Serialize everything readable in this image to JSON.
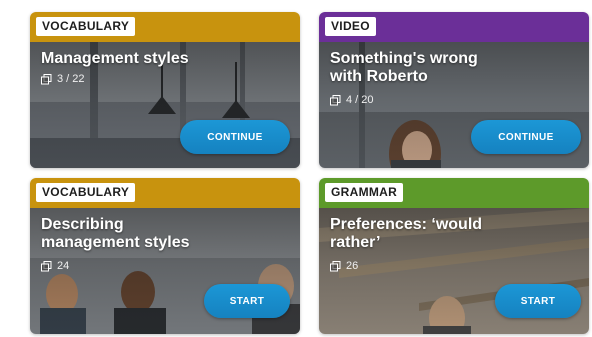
{
  "cards": [
    {
      "category": "VOCABULARY",
      "title": "Management styles",
      "count": "3 / 22",
      "button": "CONTINUE",
      "color": "#c8930e"
    },
    {
      "category": "VIDEO",
      "title": "Something's wrong with Roberto",
      "count": "4 / 20",
      "button": "CONTINUE",
      "color": "#6b2f98"
    },
    {
      "category": "VOCABULARY",
      "title": "Describing management styles",
      "count": "24",
      "button": "START",
      "color": "#c8930e"
    },
    {
      "category": "GRAMMAR",
      "title": "Preferences: ‘would rather’",
      "count": "26",
      "button": "START",
      "color": "#5d9a2a"
    }
  ],
  "icons": {
    "count": "copy-icon"
  }
}
